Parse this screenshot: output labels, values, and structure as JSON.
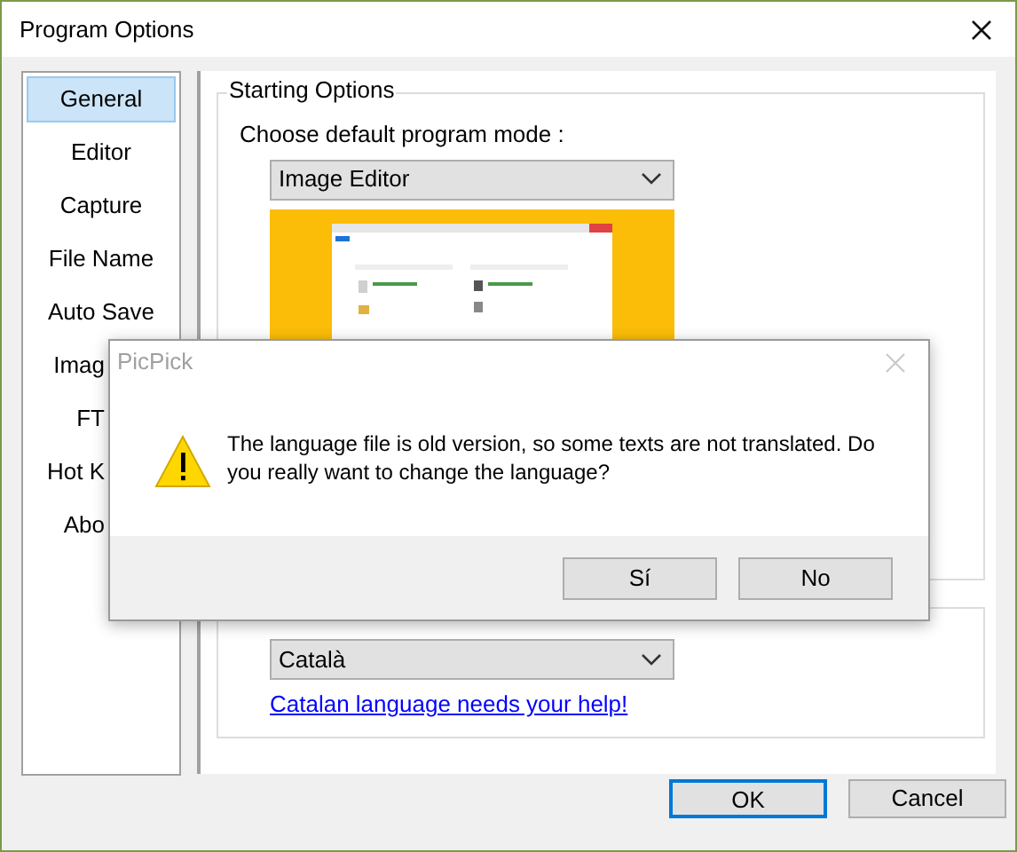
{
  "window": {
    "title": "Program Options"
  },
  "sidebar": {
    "items": [
      {
        "label": "General",
        "selected": true,
        "cut": false
      },
      {
        "label": "Editor",
        "selected": false,
        "cut": false
      },
      {
        "label": "Capture",
        "selected": false,
        "cut": false
      },
      {
        "label": "File Name",
        "selected": false,
        "cut": false
      },
      {
        "label": "Auto Save",
        "selected": false,
        "cut": false
      },
      {
        "label": "Imag",
        "selected": false,
        "cut": true
      },
      {
        "label": "FT",
        "selected": false,
        "cut": true
      },
      {
        "label": "Hot K",
        "selected": false,
        "cut": true
      },
      {
        "label": "Abo",
        "selected": false,
        "cut": true
      }
    ]
  },
  "starting_options": {
    "title": "Starting Options",
    "label": "Choose default program mode :",
    "mode": "Image Editor"
  },
  "language": {
    "value": "Català",
    "link": "Catalan language needs your help!"
  },
  "buttons": [
    "OK",
    "Cancel"
  ],
  "dialog": {
    "title": "PicPick",
    "message": "The language file is old version, so some texts are not translated. Do you really want to change the language?",
    "buttons": [
      "Sí",
      "No"
    ]
  }
}
